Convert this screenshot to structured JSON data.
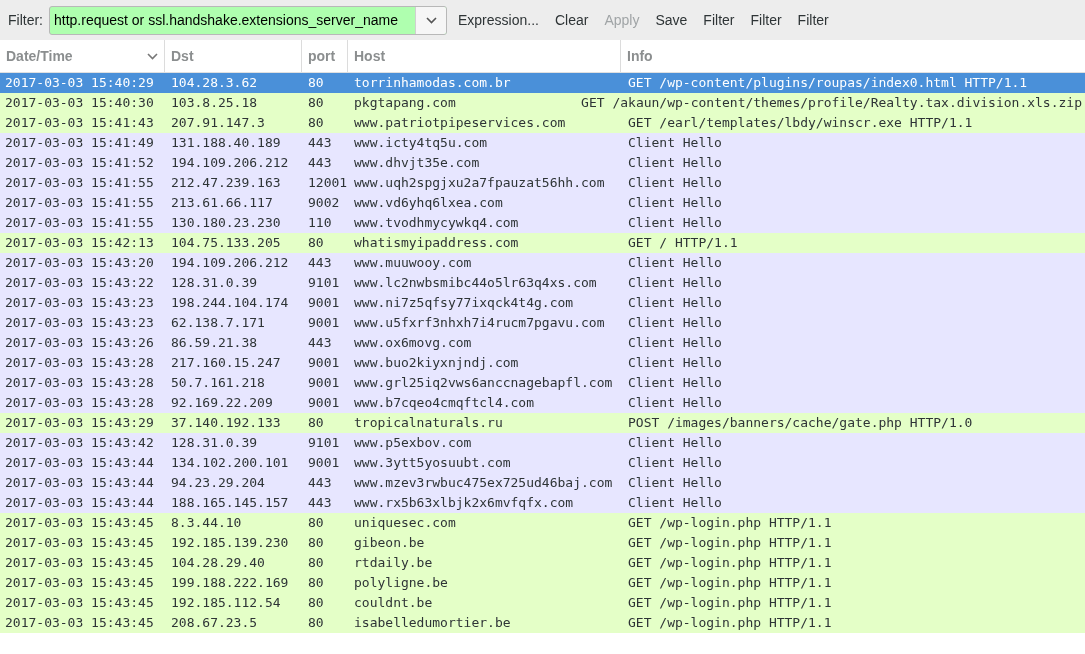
{
  "toolbar": {
    "filter_label": "Filter:",
    "filter_value": "http.request or ssl.handshake.extensions_server_name",
    "filter_valid": true,
    "buttons": [
      {
        "label": "Expression...",
        "disabled": false
      },
      {
        "label": "Clear",
        "disabled": false
      },
      {
        "label": "Apply",
        "disabled": true
      },
      {
        "label": "Save",
        "disabled": false
      },
      {
        "label": "Filter",
        "disabled": false
      },
      {
        "label": "Filter",
        "disabled": false
      },
      {
        "label": "Filter",
        "disabled": false
      }
    ]
  },
  "table": {
    "columns": [
      {
        "label": "Date/Time",
        "sorted": true
      },
      {
        "label": "Dst",
        "sorted": false
      },
      {
        "label": "port",
        "sorted": false
      },
      {
        "label": "Host",
        "sorted": false
      },
      {
        "label": "Info",
        "sorted": false
      }
    ],
    "rows": [
      {
        "selected": true,
        "cells": [
          "2017-03-03 15:40:29",
          "104.28.3.62",
          "80",
          "torrinhamodas.com.br",
          "GET /wp-content/plugins/roupas/index0.html HTTP/1.1"
        ]
      },
      {
        "kind": "http",
        "selected": false,
        "cells": [
          "2017-03-03 15:40:30",
          "103.8.25.18",
          "80",
          "pkgtapang.com",
          "GET /akaun/wp-content/themes/profile/Realty.tax.division.xls.zip"
        ]
      },
      {
        "kind": "http",
        "selected": false,
        "cells": [
          "2017-03-03 15:41:43",
          "207.91.147.3",
          "80",
          "www.patriotpipeservices.com",
          "GET /earl/templates/lbdy/winscr.exe HTTP/1.1"
        ]
      },
      {
        "kind": "tls",
        "selected": false,
        "cells": [
          "2017-03-03 15:41:49",
          "131.188.40.189",
          "443",
          "www.icty4tq5u.com",
          "Client Hello"
        ]
      },
      {
        "kind": "tls",
        "selected": false,
        "cells": [
          "2017-03-03 15:41:52",
          "194.109.206.212",
          "443",
          "www.dhvjt35e.com",
          "Client Hello"
        ]
      },
      {
        "kind": "tls",
        "selected": false,
        "cells": [
          "2017-03-03 15:41:55",
          "212.47.239.163",
          "12001",
          "www.uqh2spgjxu2a7fpauzat56hh.com",
          "Client Hello"
        ]
      },
      {
        "kind": "tls",
        "selected": false,
        "cells": [
          "2017-03-03 15:41:55",
          "213.61.66.117",
          "9002",
          "www.vd6yhq6lxea.com",
          "Client Hello"
        ]
      },
      {
        "kind": "tls",
        "selected": false,
        "cells": [
          "2017-03-03 15:41:55",
          "130.180.23.230",
          "110",
          "www.tvodhmycywkq4.com",
          "Client Hello"
        ]
      },
      {
        "kind": "http",
        "selected": false,
        "cells": [
          "2017-03-03 15:42:13",
          "104.75.133.205",
          "80",
          "whatismyipaddress.com",
          "GET / HTTP/1.1"
        ]
      },
      {
        "kind": "tls",
        "selected": false,
        "cells": [
          "2017-03-03 15:43:20",
          "194.109.206.212",
          "443",
          "www.muuwooy.com",
          "Client Hello"
        ]
      },
      {
        "kind": "tls",
        "selected": false,
        "cells": [
          "2017-03-03 15:43:22",
          "128.31.0.39",
          "9101",
          "www.lc2nwbsmibc44o5lr63q4xs.com",
          "Client Hello"
        ]
      },
      {
        "kind": "tls",
        "selected": false,
        "cells": [
          "2017-03-03 15:43:23",
          "198.244.104.174",
          "9001",
          "www.ni7z5qfsy77ixqck4t4g.com",
          "Client Hello"
        ]
      },
      {
        "kind": "tls",
        "selected": false,
        "cells": [
          "2017-03-03 15:43:23",
          "62.138.7.171",
          "9001",
          "www.u5fxrf3nhxh7i4rucm7pgavu.com",
          "Client Hello"
        ]
      },
      {
        "kind": "tls",
        "selected": false,
        "cells": [
          "2017-03-03 15:43:26",
          "86.59.21.38",
          "443",
          "www.ox6movg.com",
          "Client Hello"
        ]
      },
      {
        "kind": "tls",
        "selected": false,
        "cells": [
          "2017-03-03 15:43:28",
          "217.160.15.247",
          "9001",
          "www.buo2kiyxnjndj.com",
          "Client Hello"
        ]
      },
      {
        "kind": "tls",
        "selected": false,
        "cells": [
          "2017-03-03 15:43:28",
          "50.7.161.218",
          "9001",
          "www.grl25iq2vws6anccnagebapfl.com",
          "Client Hello"
        ]
      },
      {
        "kind": "tls",
        "selected": false,
        "cells": [
          "2017-03-03 15:43:28",
          "92.169.22.209",
          "9001",
          "www.b7cqeo4cmqftcl4.com",
          "Client Hello"
        ]
      },
      {
        "kind": "http",
        "selected": false,
        "cells": [
          "2017-03-03 15:43:29",
          "37.140.192.133",
          "80",
          "tropicalnaturals.ru",
          "POST /images/banners/cache/gate.php HTTP/1.0"
        ]
      },
      {
        "kind": "tls",
        "selected": false,
        "cells": [
          "2017-03-03 15:43:42",
          "128.31.0.39",
          "9101",
          "www.p5exbov.com",
          "Client Hello"
        ]
      },
      {
        "kind": "tls",
        "selected": false,
        "cells": [
          "2017-03-03 15:43:44",
          "134.102.200.101",
          "9001",
          "www.3ytt5yosuubt.com",
          "Client Hello"
        ]
      },
      {
        "kind": "tls",
        "selected": false,
        "cells": [
          "2017-03-03 15:43:44",
          "94.23.29.204",
          "443",
          "www.mzev3rwbuc475ex725ud46baj.com",
          "Client Hello"
        ]
      },
      {
        "kind": "tls",
        "selected": false,
        "cells": [
          "2017-03-03 15:43:44",
          "188.165.145.157",
          "443",
          "www.rx5b63xlbjk2x6mvfqfx.com",
          "Client Hello"
        ]
      },
      {
        "kind": "http",
        "selected": false,
        "cells": [
          "2017-03-03 15:43:45",
          "8.3.44.10",
          "80",
          "uniquesec.com",
          "GET /wp-login.php HTTP/1.1"
        ]
      },
      {
        "kind": "http",
        "selected": false,
        "cells": [
          "2017-03-03 15:43:45",
          "192.185.139.230",
          "80",
          "gibeon.be",
          "GET /wp-login.php HTTP/1.1"
        ]
      },
      {
        "kind": "http",
        "selected": false,
        "cells": [
          "2017-03-03 15:43:45",
          "104.28.29.40",
          "80",
          "rtdaily.be",
          "GET /wp-login.php HTTP/1.1"
        ]
      },
      {
        "kind": "http",
        "selected": false,
        "cells": [
          "2017-03-03 15:43:45",
          "199.188.222.169",
          "80",
          "polyligne.be",
          "GET /wp-login.php HTTP/1.1"
        ]
      },
      {
        "kind": "http",
        "selected": false,
        "cells": [
          "2017-03-03 15:43:45",
          "192.185.112.54",
          "80",
          "couldnt.be",
          "GET /wp-login.php HTTP/1.1"
        ]
      },
      {
        "kind": "http",
        "selected": false,
        "cells": [
          "2017-03-03 15:43:45",
          "208.67.23.5",
          "80",
          "isabelledumortier.be",
          "GET /wp-login.php HTTP/1.1"
        ]
      }
    ]
  }
}
